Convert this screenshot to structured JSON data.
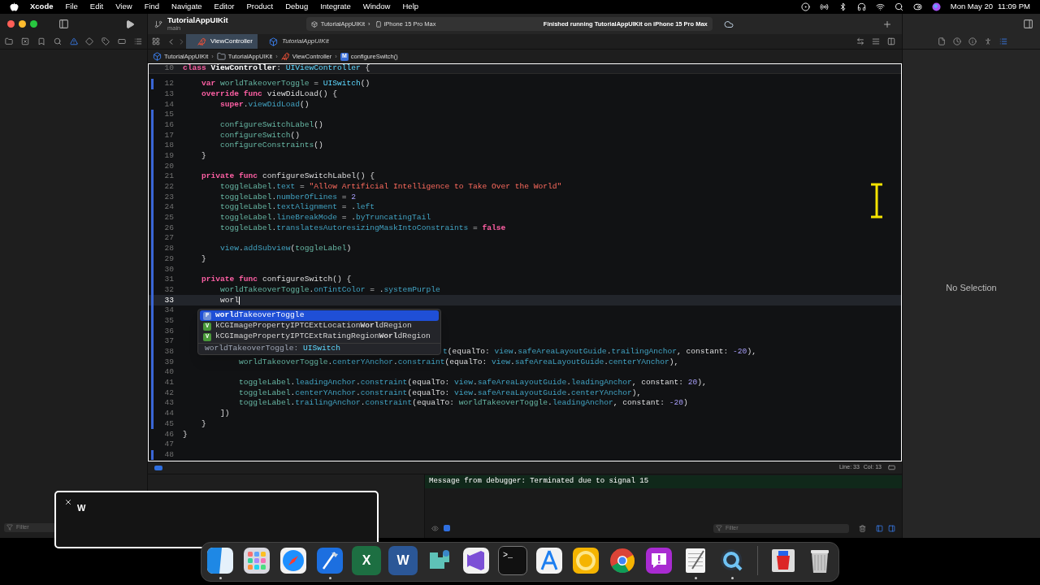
{
  "menu_bar": {
    "app": "Xcode",
    "items": [
      "File",
      "Edit",
      "View",
      "Find",
      "Navigate",
      "Editor",
      "Product",
      "Debug",
      "Integrate",
      "Window",
      "Help"
    ],
    "date": "Mon May 20",
    "time": "11:09 PM"
  },
  "toolbar": {
    "project": "TutorialAppUIKit",
    "branch": "main",
    "scheme": "TutorialAppUIKit",
    "scheme_separator": "›",
    "device": "iPhone 15 Pro Max",
    "status": "Finished running TutorialAppUIKit on iPhone 15 Pro Max"
  },
  "tabs": [
    {
      "label": "ViewController",
      "kind": "swift",
      "selected": true
    },
    {
      "label": "TutorialAppUIKit",
      "kind": "project",
      "selected": false
    }
  ],
  "breadcrumbs": [
    {
      "label": "TutorialAppUIKit",
      "kind": "project"
    },
    {
      "separator": "›",
      "label": "TutorialAppUIKit",
      "kind": "folder"
    },
    {
      "separator": "›",
      "label": "ViewController",
      "kind": "swift"
    },
    {
      "separator": "›",
      "label": "configureSwitch()",
      "kind": "method",
      "badge": "M"
    }
  ],
  "editor": {
    "sticky_line": {
      "number": "10",
      "tokens": [
        {
          "kind": "keyword",
          "text": "class "
        },
        {
          "kind": "declaration",
          "text": "ViewController"
        },
        {
          "kind": "plain",
          "text": ": "
        },
        {
          "kind": "type",
          "text": "UIViewController"
        },
        {
          "kind": "plain",
          "text": " {"
        }
      ]
    },
    "lines": [
      {
        "number": "12",
        "changed": true,
        "current": false,
        "tokens": [
          {
            "kind": "keyword",
            "text": "    var "
          },
          {
            "kind": "project",
            "text": "worldTakeoverToggle"
          },
          {
            "kind": "plain",
            "text": " = "
          },
          {
            "kind": "type",
            "text": "UISwitch"
          },
          {
            "kind": "plain",
            "text": "()"
          }
        ]
      },
      {
        "number": "13",
        "changed": false,
        "current": false,
        "tokens": [
          {
            "kind": "keyword",
            "text": "    override func "
          },
          {
            "kind": "plain",
            "text": "viewDidLoad() {"
          }
        ]
      },
      {
        "number": "14",
        "changed": false,
        "current": false,
        "tokens": [
          {
            "kind": "keyword",
            "text": "        super"
          },
          {
            "kind": "plain",
            "text": "."
          },
          {
            "kind": "system",
            "text": "viewDidLoad"
          },
          {
            "kind": "plain",
            "text": "()"
          }
        ]
      },
      {
        "number": "15",
        "changed": true,
        "current": false
      },
      {
        "number": "16",
        "changed": true,
        "current": false,
        "tokens": [
          {
            "kind": "project",
            "text": "        configureSwitchLabel"
          },
          {
            "kind": "plain",
            "text": "()"
          }
        ]
      },
      {
        "number": "17",
        "changed": true,
        "current": false,
        "tokens": [
          {
            "kind": "project",
            "text": "        configureSwitch"
          },
          {
            "kind": "plain",
            "text": "()"
          }
        ]
      },
      {
        "number": "18",
        "changed": true,
        "current": false,
        "tokens": [
          {
            "kind": "project",
            "text": "        configureConstraints"
          },
          {
            "kind": "plain",
            "text": "()"
          }
        ]
      },
      {
        "number": "19",
        "changed": true,
        "current": false,
        "tokens": [
          {
            "kind": "plain",
            "text": "    }"
          }
        ]
      },
      {
        "number": "20",
        "changed": true,
        "current": false
      },
      {
        "number": "21",
        "changed": true,
        "current": false,
        "tokens": [
          {
            "kind": "keyword",
            "text": "    private func "
          },
          {
            "kind": "plain",
            "text": "configureSwitchLabel() {"
          }
        ]
      },
      {
        "number": "22",
        "changed": true,
        "current": false,
        "tokens": [
          {
            "kind": "project",
            "text": "        toggleLabel"
          },
          {
            "kind": "plain",
            "text": "."
          },
          {
            "kind": "system",
            "text": "text"
          },
          {
            "kind": "plain",
            "text": " = "
          },
          {
            "kind": "string",
            "text": "\"Allow Artificial Intelligence to Take Over the World\""
          }
        ]
      },
      {
        "number": "23",
        "changed": true,
        "current": false,
        "tokens": [
          {
            "kind": "project",
            "text": "        toggleLabel"
          },
          {
            "kind": "plain",
            "text": "."
          },
          {
            "kind": "system",
            "text": "numberOfLines"
          },
          {
            "kind": "plain",
            "text": " = "
          },
          {
            "kind": "number",
            "text": "2"
          }
        ]
      },
      {
        "number": "24",
        "changed": true,
        "current": false,
        "tokens": [
          {
            "kind": "project",
            "text": "        toggleLabel"
          },
          {
            "kind": "plain",
            "text": "."
          },
          {
            "kind": "system",
            "text": "textAlignment"
          },
          {
            "kind": "plain",
            "text": " = ."
          },
          {
            "kind": "system",
            "text": "left"
          }
        ]
      },
      {
        "number": "25",
        "changed": true,
        "current": false,
        "tokens": [
          {
            "kind": "project",
            "text": "        toggleLabel"
          },
          {
            "kind": "plain",
            "text": "."
          },
          {
            "kind": "system",
            "text": "lineBreakMode"
          },
          {
            "kind": "plain",
            "text": " = ."
          },
          {
            "kind": "system",
            "text": "byTruncatingTail"
          }
        ]
      },
      {
        "number": "26",
        "changed": true,
        "current": false,
        "tokens": [
          {
            "kind": "project",
            "text": "        toggleLabel"
          },
          {
            "kind": "plain",
            "text": "."
          },
          {
            "kind": "system",
            "text": "translatesAutoresizingMaskIntoConstraints"
          },
          {
            "kind": "plain",
            "text": " = "
          },
          {
            "kind": "keyword",
            "text": "false"
          }
        ]
      },
      {
        "number": "27",
        "changed": true,
        "current": false
      },
      {
        "number": "28",
        "changed": true,
        "current": false,
        "tokens": [
          {
            "kind": "system",
            "text": "        view"
          },
          {
            "kind": "plain",
            "text": "."
          },
          {
            "kind": "system",
            "text": "addSubview"
          },
          {
            "kind": "plain",
            "text": "("
          },
          {
            "kind": "project",
            "text": "toggleLabel"
          },
          {
            "kind": "plain",
            "text": ")"
          }
        ]
      },
      {
        "number": "29",
        "changed": true,
        "current": false,
        "tokens": [
          {
            "kind": "plain",
            "text": "    }"
          }
        ]
      },
      {
        "number": "30",
        "changed": true,
        "current": false
      },
      {
        "number": "31",
        "changed": true,
        "current": false,
        "tokens": [
          {
            "kind": "keyword",
            "text": "    private func "
          },
          {
            "kind": "plain",
            "text": "configureSwitch() {"
          }
        ]
      },
      {
        "number": "32",
        "changed": true,
        "current": false,
        "tokens": [
          {
            "kind": "project",
            "text": "        worldTakeoverToggle"
          },
          {
            "kind": "plain",
            "text": "."
          },
          {
            "kind": "system",
            "text": "onTintColor"
          },
          {
            "kind": "plain",
            "text": " = ."
          },
          {
            "kind": "system",
            "text": "systemPurple"
          }
        ]
      },
      {
        "number": "33",
        "changed": true,
        "current": true,
        "tokens": [
          {
            "kind": "plain",
            "text": "        worl"
          }
        ]
      },
      {
        "number": "34",
        "changed": true,
        "current": false
      },
      {
        "number": "35",
        "changed": true,
        "current": false
      },
      {
        "number": "36",
        "changed": true,
        "current": false
      },
      {
        "number": "37",
        "changed": true,
        "current": false
      },
      {
        "number": "38",
        "changed": true,
        "current": false,
        "covered": true,
        "tokens": [
          {
            "kind": "system",
            "text": "t"
          },
          {
            "kind": "plain",
            "text": "(equalTo: "
          },
          {
            "kind": "system",
            "text": "view"
          },
          {
            "kind": "plain",
            "text": "."
          },
          {
            "kind": "system",
            "text": "safeAreaLayoutGuide"
          },
          {
            "kind": "plain",
            "text": "."
          },
          {
            "kind": "system",
            "text": "trailingAnchor"
          },
          {
            "kind": "plain",
            "text": ", constant: "
          },
          {
            "kind": "number",
            "text": "-20"
          },
          {
            "kind": "plain",
            "text": "),"
          }
        ]
      },
      {
        "number": "39",
        "changed": true,
        "current": false,
        "tokens": [
          {
            "kind": "project",
            "text": "            worldTakeoverToggle"
          },
          {
            "kind": "plain",
            "text": "."
          },
          {
            "kind": "system",
            "text": "centerYAnchor"
          },
          {
            "kind": "plain",
            "text": "."
          },
          {
            "kind": "system",
            "text": "constraint"
          },
          {
            "kind": "plain",
            "text": "(equalTo: "
          },
          {
            "kind": "system",
            "text": "view"
          },
          {
            "kind": "plain",
            "text": "."
          },
          {
            "kind": "system",
            "text": "safeAreaLayoutGuide"
          },
          {
            "kind": "plain",
            "text": "."
          },
          {
            "kind": "system",
            "text": "centerYAnchor"
          },
          {
            "kind": "plain",
            "text": "),"
          }
        ]
      },
      {
        "number": "40",
        "changed": true,
        "current": false
      },
      {
        "number": "41",
        "changed": true,
        "current": false,
        "tokens": [
          {
            "kind": "project",
            "text": "            toggleLabel"
          },
          {
            "kind": "plain",
            "text": "."
          },
          {
            "kind": "system",
            "text": "leadingAnchor"
          },
          {
            "kind": "plain",
            "text": "."
          },
          {
            "kind": "system",
            "text": "constraint"
          },
          {
            "kind": "plain",
            "text": "(equalTo: "
          },
          {
            "kind": "system",
            "text": "view"
          },
          {
            "kind": "plain",
            "text": "."
          },
          {
            "kind": "system",
            "text": "safeAreaLayoutGuide"
          },
          {
            "kind": "plain",
            "text": "."
          },
          {
            "kind": "system",
            "text": "leadingAnchor"
          },
          {
            "kind": "plain",
            "text": ", constant: "
          },
          {
            "kind": "number",
            "text": "20"
          },
          {
            "kind": "plain",
            "text": "),"
          }
        ]
      },
      {
        "number": "42",
        "changed": true,
        "current": false,
        "tokens": [
          {
            "kind": "project",
            "text": "            toggleLabel"
          },
          {
            "kind": "plain",
            "text": "."
          },
          {
            "kind": "system",
            "text": "centerYAnchor"
          },
          {
            "kind": "plain",
            "text": "."
          },
          {
            "kind": "system",
            "text": "constraint"
          },
          {
            "kind": "plain",
            "text": "(equalTo: "
          },
          {
            "kind": "system",
            "text": "view"
          },
          {
            "kind": "plain",
            "text": "."
          },
          {
            "kind": "system",
            "text": "safeAreaLayoutGuide"
          },
          {
            "kind": "plain",
            "text": "."
          },
          {
            "kind": "system",
            "text": "centerYAnchor"
          },
          {
            "kind": "plain",
            "text": "),"
          }
        ]
      },
      {
        "number": "43",
        "changed": true,
        "current": false,
        "tokens": [
          {
            "kind": "project",
            "text": "            toggleLabel"
          },
          {
            "kind": "plain",
            "text": "."
          },
          {
            "kind": "system",
            "text": "trailingAnchor"
          },
          {
            "kind": "plain",
            "text": "."
          },
          {
            "kind": "system",
            "text": "constraint"
          },
          {
            "kind": "plain",
            "text": "(equalTo: "
          },
          {
            "kind": "project",
            "text": "worldTakeoverToggle"
          },
          {
            "kind": "plain",
            "text": "."
          },
          {
            "kind": "system",
            "text": "leadingAnchor"
          },
          {
            "kind": "plain",
            "text": ", constant: "
          },
          {
            "kind": "number",
            "text": "-20"
          },
          {
            "kind": "plain",
            "text": ")"
          }
        ]
      },
      {
        "number": "44",
        "changed": true,
        "current": false,
        "tokens": [
          {
            "kind": "plain",
            "text": "        ])"
          }
        ]
      },
      {
        "number": "45",
        "changed": true,
        "current": false,
        "tokens": [
          {
            "kind": "plain",
            "text": "    }"
          }
        ]
      },
      {
        "number": "46",
        "changed": false,
        "current": false,
        "tokens": [
          {
            "kind": "plain",
            "text": "}"
          }
        ]
      },
      {
        "number": "47",
        "changed": false,
        "current": false
      },
      {
        "number": "48",
        "changed": true,
        "current": false
      }
    ]
  },
  "autocomplete": {
    "items": [
      {
        "badge": "P",
        "kind": "property",
        "text": "**worl**dTakeoverToggle",
        "selected": true
      },
      {
        "badge": "V",
        "kind": "variable",
        "text": "kCGImagePropertyIPTCExtLocation**Worl**dRegion",
        "selected": false
      },
      {
        "badge": "V",
        "kind": "variable",
        "text": "kCGImagePropertyIPTCExtRatingRegion**Worl**dRegion",
        "selected": false
      }
    ],
    "detail_name": "worldTakeoverToggle:",
    "detail_type": "UISwitch"
  },
  "status_bar": {
    "line": "Line: 33",
    "col": "Col: 13"
  },
  "inspector": {
    "empty_text": "No Selection"
  },
  "console": {
    "message": "Message from debugger: Terminated due to signal 15",
    "filter_placeholder": "Filter"
  },
  "navigator": {
    "filter_placeholder": "Filter"
  },
  "keystroke_overlay": {
    "text": "W"
  },
  "dock": [
    {
      "kind": "finder",
      "running": true
    },
    {
      "kind": "launchpad",
      "running": false
    },
    {
      "kind": "safari",
      "running": false
    },
    {
      "kind": "xcode",
      "running": true
    },
    {
      "kind": "excel",
      "glyph": "X",
      "running": false
    },
    {
      "kind": "word",
      "glyph": "W",
      "running": false
    },
    {
      "kind": "puzzle",
      "running": false
    },
    {
      "kind": "ribbon",
      "running": false
    },
    {
      "kind": "terminal",
      "glyph": ">_",
      "running": false
    },
    {
      "kind": "drafting",
      "running": false
    },
    {
      "kind": "ring",
      "running": false
    },
    {
      "kind": "chrome",
      "running": false
    },
    {
      "kind": "bubble",
      "running": false
    },
    {
      "kind": "notepad",
      "running": true
    },
    {
      "kind": "quicktime",
      "running": true
    },
    {
      "kind": "bucket",
      "running": false
    },
    {
      "kind": "trash",
      "running": false
    }
  ]
}
